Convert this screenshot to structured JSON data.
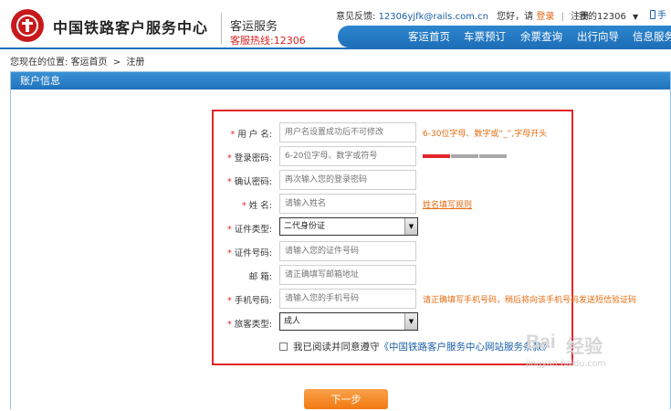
{
  "header": {
    "site_name": "中国铁路客户服务中心",
    "service": "客运服务",
    "hotline": "客服热线:12306",
    "feedback_label": "意见反馈:",
    "feedback_email": "12306yjfk@rails.com.cn",
    "greeting": "您好，请",
    "login": "登录",
    "sep": "|",
    "register": "注册",
    "my12306": "我的12306",
    "phone": "手",
    "brand_color": "#c8191c"
  },
  "nav": {
    "items": [
      "客运首页",
      "车票预订",
      "余票查询",
      "出行向导",
      "信息服务"
    ]
  },
  "breadcrumb": {
    "prefix": "您现在的位置:",
    "home": "客运首页",
    "sep": ">",
    "current": "注册"
  },
  "panel": {
    "title": "账户信息"
  },
  "form": {
    "username": {
      "label": "用 户 名:",
      "placeholder": "用户名设置成功后不可修改",
      "hint": "6-30位字母、数字或“_”,字母开头"
    },
    "password": {
      "label": "登录密码:",
      "placeholder": "6-20位字母、数字或符号",
      "strength_colors": [
        "#e2252b",
        "#a8a8a8",
        "#a8a8a8"
      ]
    },
    "confirm": {
      "label": "确认密码:",
      "placeholder": "再次输入您的登录密码"
    },
    "name": {
      "label": "姓    名:",
      "placeholder": "请输入姓名",
      "hint": "姓名填写规则"
    },
    "id_type": {
      "label": "证件类型:",
      "value": "二代身份证"
    },
    "id_number": {
      "label": "证件号码:",
      "placeholder": "请输入您的证件号码"
    },
    "email": {
      "label": "邮    箱:",
      "placeholder": "请正确填写邮箱地址"
    },
    "mobile": {
      "label": "手机号码:",
      "placeholder": "请输入您的手机号码",
      "hint": "请正确填写手机号码，稍后将向该手机号码发送短信验证码"
    },
    "passenger_type": {
      "label": "旅客类型:",
      "value": "成人"
    },
    "agree_text": "我已阅读并同意遵守",
    "agree_link": "《中国铁路客户服务中心网站服务条款》",
    "star": "*",
    "next": "下一步"
  },
  "watermark": {
    "baidu": "Bai",
    "jingyan": "经验",
    "url": "jingyan.baidu.com"
  }
}
